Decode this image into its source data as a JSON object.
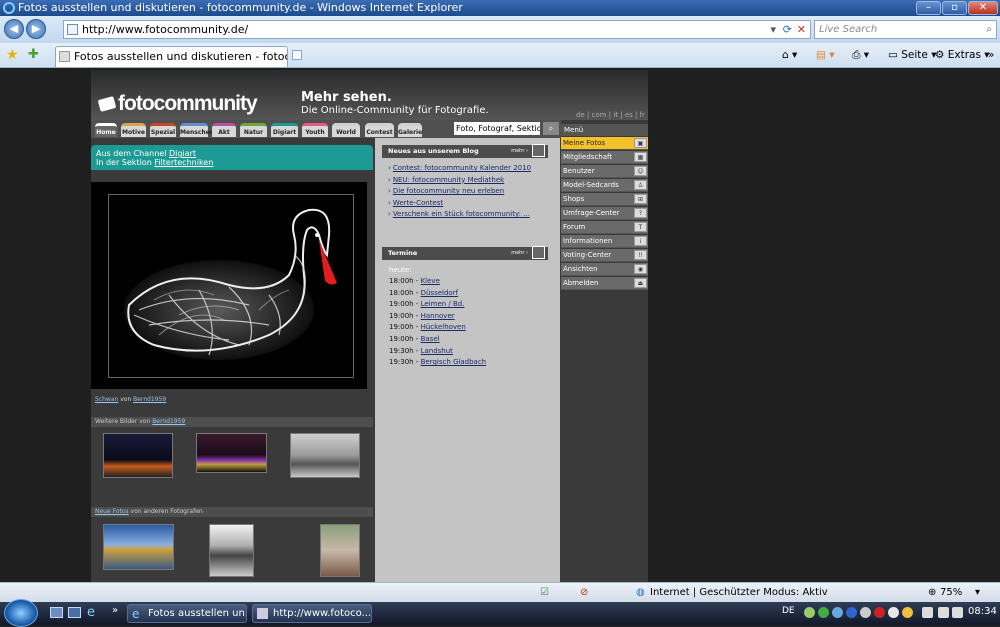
{
  "window": {
    "title": "Fotos ausstellen und diskutieren - fotocommunity.de - Windows Internet Explorer"
  },
  "addressbar": {
    "url": "http://www.fotocommunity.de/",
    "search_placeholder": "Live Search"
  },
  "tabbar": {
    "tab_title": "Fotos ausstellen und diskutieren - fotocommunit...",
    "page_label": "Seite",
    "extras_label": "Extras"
  },
  "site": {
    "logo": "fotocommunity",
    "slogan_title": "Mehr sehen.",
    "slogan_sub": "Die Online-Community für Fotografie.",
    "languages": "de | com | it | es | fr",
    "nav_tabs": [
      {
        "label": "Home",
        "color": "#ffffff"
      },
      {
        "label": "Motive",
        "color": "#d9a34a"
      },
      {
        "label": "Spezial",
        "color": "#c8442f"
      },
      {
        "label": "Menschen",
        "color": "#5f8fd0"
      },
      {
        "label": "Akt",
        "color": "#b84fa6"
      },
      {
        "label": "Natur",
        "color": "#6ba83a"
      },
      {
        "label": "Digiart",
        "color": "#1d9a94"
      },
      {
        "label": "Youth",
        "color": "#e55a82"
      },
      {
        "label": "World",
        "color": "#d0d0d0"
      },
      {
        "label": "Contest",
        "color": "#d0d0d0"
      },
      {
        "label": "Galerie",
        "color": "#d0d0d0"
      }
    ],
    "search_value": "Foto, Fotograf, Sektion, ...",
    "channel": {
      "line1_prefix": "Aus dem Channel ",
      "channel_name": "Digiart",
      "line2_prefix": "In der Sektion ",
      "section_name": "Filtertechniken"
    },
    "photo_caption": {
      "title": "Schwan",
      "by": "von",
      "author": "Bernd1959"
    },
    "more_from": {
      "prefix": "Weitere Bilder von ",
      "author": "Bernd1959"
    },
    "new_photos": {
      "link": "Neue Fotos",
      "suffix": " von anderen Fotografen"
    },
    "blog": {
      "heading": "Neues aus unserem Blog",
      "mehr": "mehr ›",
      "items": [
        "Contest: fotocommunity Kalender 2010",
        "NEU: fotocommunity Mediathek",
        "Die fotocommunity neu erleben",
        "Werte-Contest",
        "Verschenk ein Stück fotocommunity: ..."
      ]
    },
    "termine": {
      "heading": "Termine",
      "mehr": "mehr ›",
      "today_label": "heute:",
      "items": [
        {
          "time": "18:00h - ",
          "place": "Kleve"
        },
        {
          "time": "18:00h - ",
          "place": "Düsseldorf"
        },
        {
          "time": "19:00h - ",
          "place": "Leimen / Bd."
        },
        {
          "time": "19:00h - ",
          "place": "Hannover"
        },
        {
          "time": "19:00h - ",
          "place": "Hückelhoven"
        },
        {
          "time": "19:00h - ",
          "place": "Basel"
        },
        {
          "time": "19:30h - ",
          "place": "Landshut"
        },
        {
          "time": "19:30h - ",
          "place": "Bergisch Gladbach"
        }
      ]
    },
    "menu": {
      "heading": "Menü",
      "items": [
        {
          "label": "Meine Fotos",
          "icon": "camera-icon",
          "glyph": "▣"
        },
        {
          "label": "Mitgliedschaft",
          "icon": "grid-icon",
          "glyph": "▦"
        },
        {
          "label": "Benutzer",
          "icon": "users-icon",
          "glyph": "☺"
        },
        {
          "label": "Model-Sedcards",
          "icon": "sedcard-icon",
          "glyph": "♙"
        },
        {
          "label": "Shops",
          "icon": "cart-icon",
          "glyph": "⊞"
        },
        {
          "label": "Umfrage-Center",
          "icon": "question-icon",
          "glyph": "?"
        },
        {
          "label": "Forum",
          "icon": "forum-icon",
          "glyph": "T"
        },
        {
          "label": "Informationen",
          "icon": "info-icon",
          "glyph": "i"
        },
        {
          "label": "Voting-Center",
          "icon": "voting-icon",
          "glyph": "!!"
        },
        {
          "label": "Ansichten",
          "icon": "eye-icon",
          "glyph": "◉"
        },
        {
          "label": "Abmelden",
          "icon": "eject-icon",
          "glyph": "⏏"
        }
      ]
    }
  },
  "statusbar": {
    "zone": "Internet | Geschützter Modus: Aktiv",
    "zoom": "75%"
  },
  "taskbar": {
    "task1": "Fotos ausstellen un...",
    "task2": "http://www.fotoco...",
    "language": "DE",
    "clock": "08:34"
  }
}
